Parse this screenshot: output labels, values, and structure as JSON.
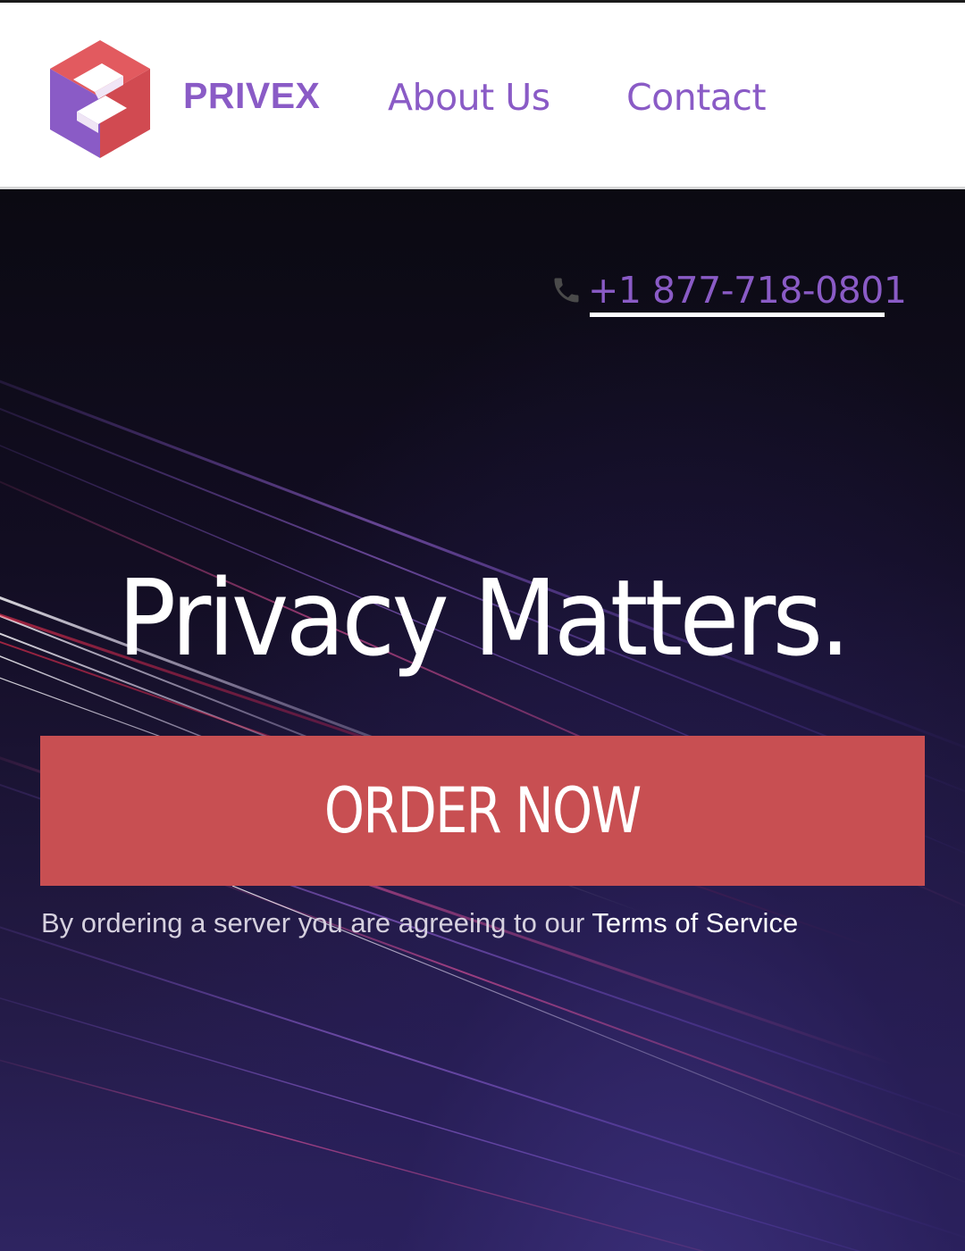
{
  "theme": {
    "brand_color": "#8a5bc6",
    "cta_color": "#c84f52",
    "logo_colors": [
      "#e0575c",
      "#8a5bc6",
      "#ffffff"
    ]
  },
  "header": {
    "logo_icon": "privex-cube-logo",
    "brand": "PRIVEX",
    "nav": [
      {
        "label": "About Us"
      },
      {
        "label": "Contact"
      }
    ]
  },
  "hero": {
    "phone_icon": "phone-icon",
    "phone": "+1 877-718-0801",
    "headline": "Privacy Matters.",
    "cta_label": "ORDER NOW",
    "terms_prefix": "By ordering a server you are agreeing to our ",
    "terms_link": "Terms of Service"
  }
}
